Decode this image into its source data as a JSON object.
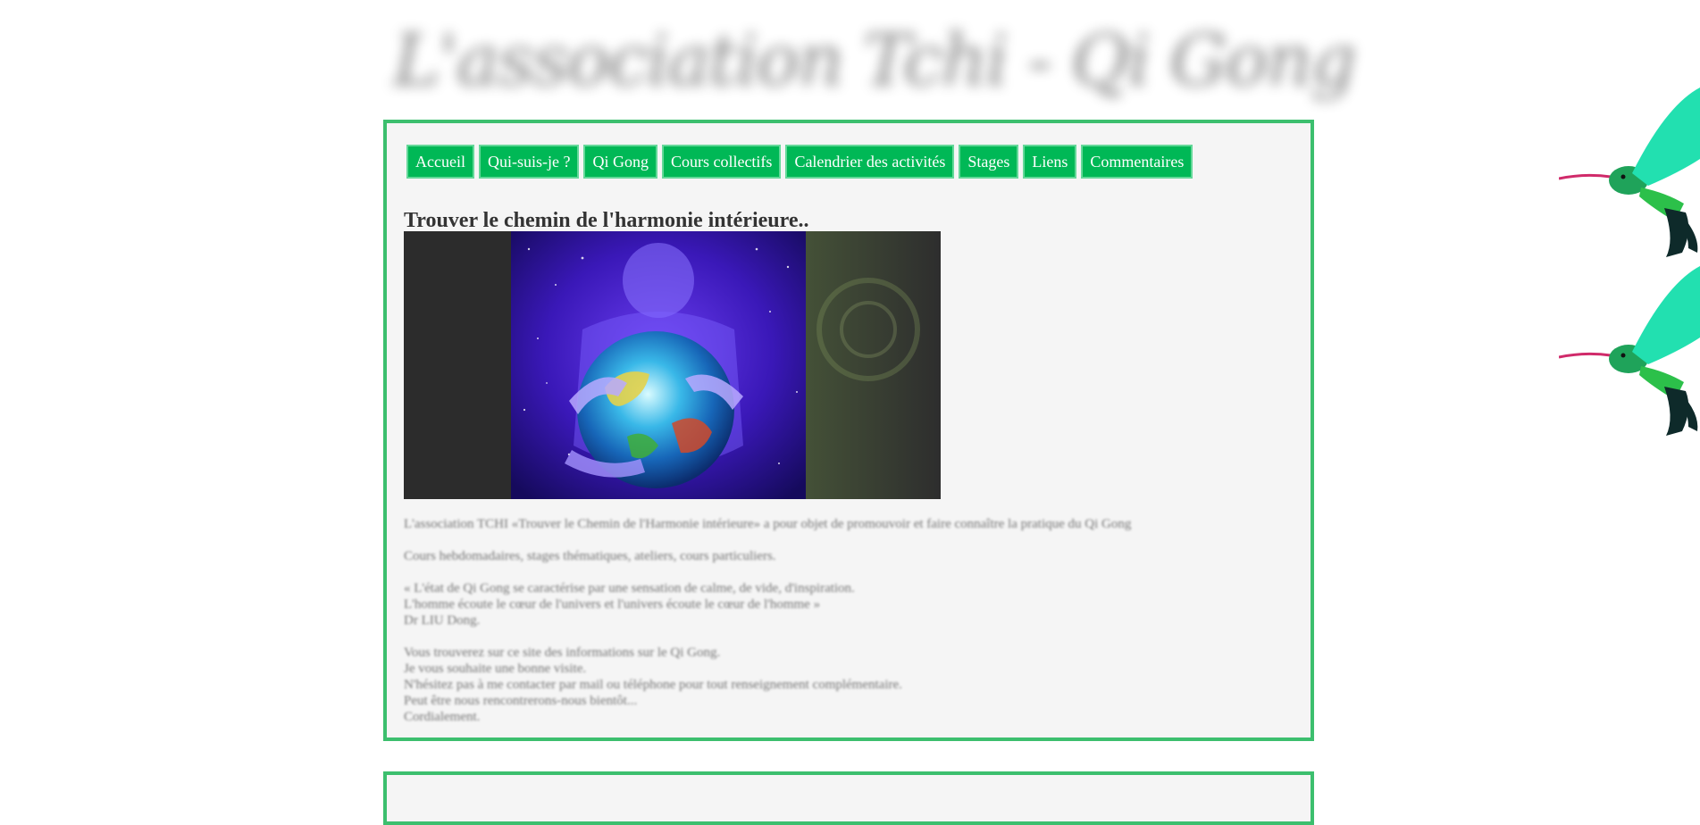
{
  "header": {
    "logo_text": "L'association Tchi - Qi Gong"
  },
  "nav": {
    "items": [
      {
        "label": "Accueil"
      },
      {
        "label": "Qui-suis-je ?"
      },
      {
        "label": "Qi Gong"
      },
      {
        "label": "Cours collectifs"
      },
      {
        "label": "Calendrier des activités"
      },
      {
        "label": "Stages"
      },
      {
        "label": "Liens"
      },
      {
        "label": "Commentaires"
      }
    ]
  },
  "main": {
    "title": "Trouver le chemin de l'harmonie intérieure..",
    "paragraphs": [
      [
        "L'association TCHI «Trouver le Chemin de l'Harmonie intérieure» a pour objet de promouvoir et faire connaître la pratique du Qi Gong"
      ],
      [
        "Cours hebdomadaires, stages thématiques, ateliers, cours particuliers."
      ],
      [
        "« L'état de Qi Gong se caractérise par une sensation de calme, de vide, d'inspiration.",
        "L'homme écoute le cœur de l'univers et l'univers écoute le cœur de l'homme »",
        "Dr LIU Dong."
      ],
      [
        "Vous trouverez sur ce site des informations sur le Qi Gong.",
        "Je vous souhaite une bonne visite.",
        "N'hésitez pas à me contacter par mail ou téléphone pour tout renseignement complémentaire.",
        "Peut être nous rencontrerons-nous bientôt...",
        "Cordialement."
      ]
    ]
  },
  "colors": {
    "accent": "#3cbf6e",
    "nav_bg": "#00b856",
    "panel_bg": "#f5f5f5"
  },
  "icons": {
    "decoration": "hummingbird-icon"
  }
}
